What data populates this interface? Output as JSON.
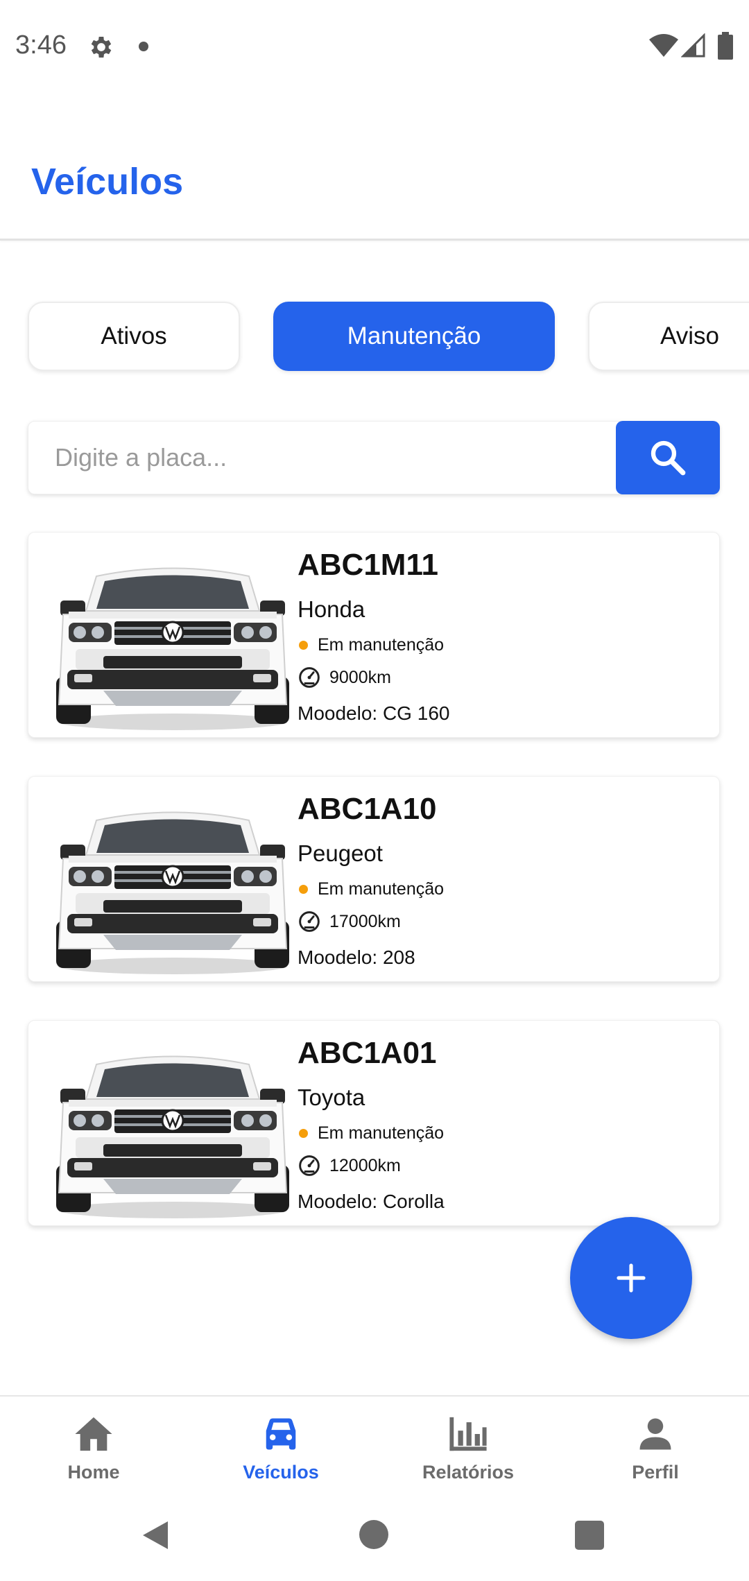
{
  "status_bar": {
    "time": "3:46"
  },
  "header": {
    "title": "Veículos"
  },
  "tabs": [
    {
      "label": "Ativos",
      "active": false
    },
    {
      "label": "Manutenção",
      "active": true
    },
    {
      "label": "Aviso",
      "active": false
    }
  ],
  "search": {
    "placeholder": "Digite a placa...",
    "value": ""
  },
  "vehicles": [
    {
      "plate": "ABC1M11",
      "brand": "Honda",
      "status": "Em manutenção",
      "km": "9000km",
      "model": "Moodelo: CG 160"
    },
    {
      "plate": "ABC1A10",
      "brand": "Peugeot",
      "status": "Em manutenção",
      "km": "17000km",
      "model": "Moodelo: 208"
    },
    {
      "plate": "ABC1A01",
      "brand": "Toyota",
      "status": "Em manutenção",
      "km": "12000km",
      "model": "Moodelo: Corolla"
    }
  ],
  "bottom_nav": [
    {
      "label": "Home",
      "icon": "home-icon",
      "active": false
    },
    {
      "label": "Veículos",
      "icon": "car-icon",
      "active": true
    },
    {
      "label": "Relatórios",
      "icon": "bar-chart-icon",
      "active": false
    },
    {
      "label": "Perfil",
      "icon": "person-icon",
      "active": false
    }
  ],
  "colors": {
    "accent": "#2563eb",
    "status_dot": "#f59e0b",
    "inactive": "#6b6b6b"
  }
}
